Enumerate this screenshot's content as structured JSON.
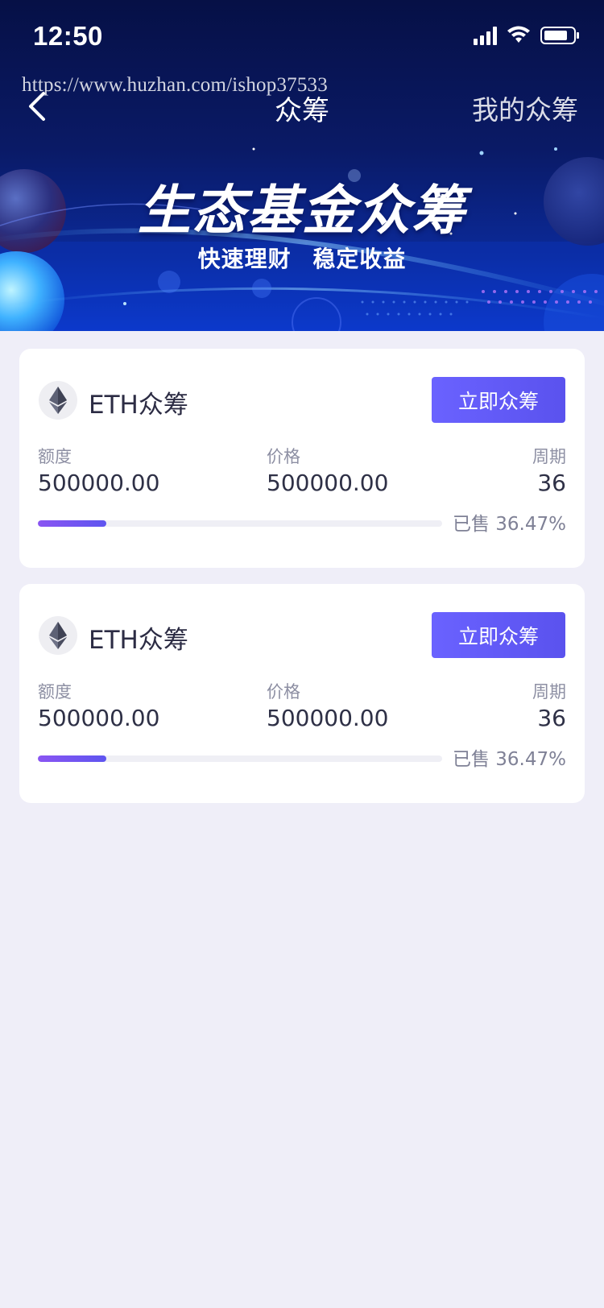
{
  "status_bar": {
    "time": "12:50",
    "icons": [
      "signal-icon",
      "wifi-icon",
      "battery-icon"
    ]
  },
  "watermark": "https://www.huzhan.com/ishop37533",
  "nav": {
    "back_icon": "chevron-left-icon",
    "title": "众筹",
    "right_action": "我的众筹"
  },
  "banner": {
    "title": "生态基金众筹",
    "subtitle": "快速理财 稳定收益"
  },
  "colors": {
    "accent": "#5b55f0",
    "progress": "#7a55f2",
    "banner_dark": "#061046",
    "page_bg": "#efeef8"
  },
  "cards": [
    {
      "coin_icon": "ethereum-icon",
      "name": "ETH众筹",
      "button": "立即众筹",
      "quota_label": "额度",
      "quota_value": "500000.00",
      "price_label": "价格",
      "price_value": "500000.00",
      "period_label": "周期",
      "period_value": "36",
      "sold_text": "已售 36.47%",
      "progress": 0.17
    },
    {
      "coin_icon": "ethereum-icon",
      "name": "ETH众筹",
      "button": "立即众筹",
      "quota_label": "额度",
      "quota_value": "500000.00",
      "price_label": "价格",
      "price_value": "500000.00",
      "period_label": "周期",
      "period_value": "36",
      "sold_text": "已售 36.47%",
      "progress": 0.17
    }
  ]
}
